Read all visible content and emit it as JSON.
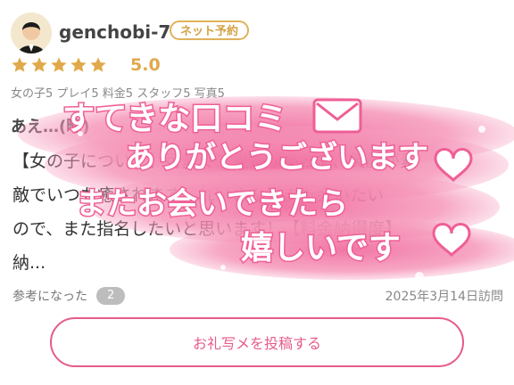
{
  "review": {
    "username": "genchobi-7",
    "badge": "ネット予約",
    "rating": "5.0",
    "scores": "女の子5 プレイ5 料金5 スタッフ5 写真5",
    "title": "あえ…(略)",
    "body_lines": [
      "【女の子について】可愛くて愛嬌があって、笑顔が素",
      "敵でいつも癒されます。れいさんにまた会いたい",
      "ので、また指名したいと思います！【料金納得度】",
      "納..."
    ],
    "helpful_label": "参考になった",
    "helpful_count": "2",
    "visit_date": "2025年3月14日訪問"
  },
  "overlay": {
    "line1": "すてきな口コミ",
    "line2": "ありがとうございます",
    "line3": "またお会いできたら",
    "line4": "嬉しいです"
  },
  "buttons": {
    "post_label": "お礼写メを投稿する"
  },
  "icons": {
    "avatar": "avatar-icon",
    "star": "star-icon",
    "envelope": "envelope-icon",
    "heart": "heart-icon"
  },
  "colors": {
    "accent": "#e55d8a",
    "star": "#e0a94a",
    "badge": "#e0b25a"
  }
}
